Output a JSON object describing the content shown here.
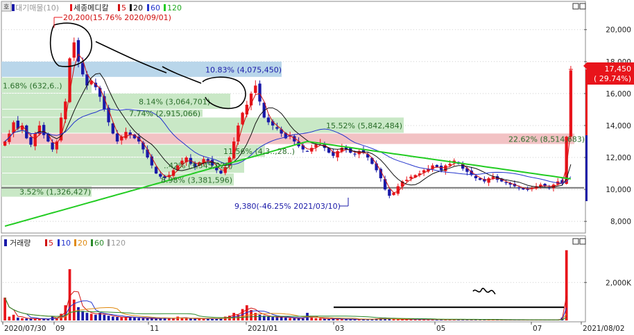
{
  "price_panel": {
    "legend": {
      "stock": "대기매물(10)",
      "ind": "세종메디칼",
      "ma5": "5",
      "ma20": "20",
      "ma60": "60",
      "ma120": "120"
    },
    "high_label": "20,200(15.76% 2020/09/01)",
    "low_label": "9,380(-46.25% 2021/03/10)",
    "current_label_price": "17,450",
    "current_label_pct": "( 29.74%)",
    "corner_btn": "호"
  },
  "volume_panel": {
    "legend": {
      "name": "거래량",
      "ma5": "5",
      "ma10": "10",
      "ma20": "20",
      "ma60": "60",
      "ma120": "120"
    }
  },
  "colors": {
    "up": "#e8141b",
    "down": "#1a1aa8",
    "ma5": "#d01010",
    "ma20": "#111111",
    "ma60": "#2233cc",
    "ma120": "#22cc22",
    "zone_blue": "#b9d6ea",
    "zone_green": "#c9e8c6",
    "zone_red": "#f2c2c4"
  },
  "chart_data": [
    {
      "type": "candlestick",
      "title": "세종메디칼",
      "x_ticks": [
        "2020/07/30",
        "09",
        "11",
        "2021/01",
        "03",
        "05",
        "07",
        "2021/08/02"
      ],
      "y_ticks": [
        "8,000",
        "10,000",
        "12,000",
        "14,000",
        "16,000",
        "18,000",
        "20,000"
      ],
      "ylim": [
        7000,
        21000
      ],
      "high": {
        "value": 20200,
        "pct": 15.76,
        "date": "2020/09/01"
      },
      "low": {
        "value": 9380,
        "pct": -46.25,
        "date": "2021/03/10"
      },
      "current": {
        "value": 17450,
        "pct": 29.74
      },
      "price_zones": [
        {
          "label": "10.83% (4,075,450)",
          "low": 17000,
          "high": 18000,
          "color": "blue"
        },
        {
          "label": "1.68% (632,6..)",
          "low": 16000,
          "high": 17000,
          "color": "green"
        },
        {
          "label": "8.14% (3,064,701)",
          "low": 15000,
          "high": 16000,
          "color": "green"
        },
        {
          "label": "7.74% (2,915,066)",
          "low": 14500,
          "high": 15000,
          "color": "green"
        },
        {
          "label": "15.52% (5,842,484)",
          "low": 13500,
          "high": 14500,
          "color": "green"
        },
        {
          "label": "22.62% (8,514,683)",
          "low": 12800,
          "high": 13500,
          "color": "red"
        },
        {
          "label": "11.56% (4,3..,28..)",
          "low": 12000,
          "high": 12800,
          "color": "green"
        },
        {
          "label": "..42% (3,545,025)",
          "low": 11000,
          "high": 12000,
          "color": "green"
        },
        {
          "label": "8.98% (3,381,596)",
          "low": 10200,
          "high": 11000,
          "color": "green"
        },
        {
          "label": "3.52% (1,326,427)",
          "low": 9500,
          "high": 10200,
          "color": "green"
        }
      ],
      "support_line": 10100,
      "close_series": [
        13000,
        13500,
        14200,
        13800,
        14000,
        13200,
        12800,
        13500,
        14000,
        13400,
        13000,
        12500,
        13000,
        14500,
        15500,
        18200,
        19200,
        18000,
        17200,
        16500,
        16800,
        16400,
        15800,
        15000,
        14200,
        13500,
        13000,
        13300,
        13600,
        13400,
        13200,
        13000,
        12500,
        12000,
        11500,
        11000,
        10800,
        10700,
        10900,
        11200,
        11500,
        11800,
        12000,
        11600,
        11400,
        11700,
        11900,
        11800,
        11500,
        11200,
        11000,
        11400,
        12000,
        13000,
        14000,
        14800,
        15300,
        16000,
        16500,
        15500,
        14500,
        14200,
        14000,
        13800,
        13500,
        13200,
        13400,
        13000,
        12700,
        12500,
        12400,
        12600,
        12800,
        12900,
        12600,
        12300,
        12100,
        12400,
        12600,
        12500,
        12300,
        12200,
        12400,
        12300,
        12000,
        11600,
        11200,
        10700,
        10000,
        9600,
        9800,
        10200,
        10500,
        10600,
        10800,
        10900,
        11000,
        11200,
        11300,
        11500,
        11400,
        11200,
        11500,
        11600,
        11800,
        11600,
        11300,
        11100,
        10900,
        10700,
        10600,
        10500,
        10700,
        10800,
        10600,
        10500,
        10400,
        10300,
        10200,
        10100,
        10000,
        10000,
        10100,
        10200,
        10300,
        10200,
        10100,
        10300,
        10500,
        10400,
        13300,
        17450
      ]
    },
    {
      "type": "bar",
      "title": "거래량",
      "y_ticks": [
        "2,000K"
      ],
      "ylim": [
        0,
        4000
      ],
      "unit": "K",
      "values": [
        1200,
        200,
        300,
        150,
        120,
        100,
        100,
        80,
        90,
        70,
        60,
        200,
        150,
        350,
        800,
        2700,
        1100,
        700,
        500,
        400,
        350,
        300,
        400,
        300,
        250,
        200,
        180,
        160,
        150,
        200,
        150,
        130,
        120,
        110,
        100,
        90,
        120,
        150,
        100,
        90,
        200,
        130,
        110,
        100,
        90,
        80,
        110,
        100,
        90,
        80,
        120,
        200,
        250,
        400,
        300,
        600,
        800,
        550,
        400,
        300,
        250,
        200,
        180,
        160,
        200,
        150,
        130,
        120,
        110,
        100,
        400,
        150,
        120,
        100,
        90,
        80,
        90,
        80,
        70,
        60,
        60,
        50,
        60,
        55,
        60,
        80,
        100,
        120,
        150,
        80,
        60,
        50,
        60,
        55,
        60,
        50,
        45,
        50,
        45,
        40,
        45,
        40,
        35,
        40,
        45,
        40,
        35,
        30,
        35,
        40,
        35,
        30,
        30,
        35,
        30,
        28,
        30,
        30,
        28,
        26,
        25,
        25,
        28,
        30,
        28,
        26,
        30,
        35,
        30,
        150,
        3700
      ]
    }
  ]
}
